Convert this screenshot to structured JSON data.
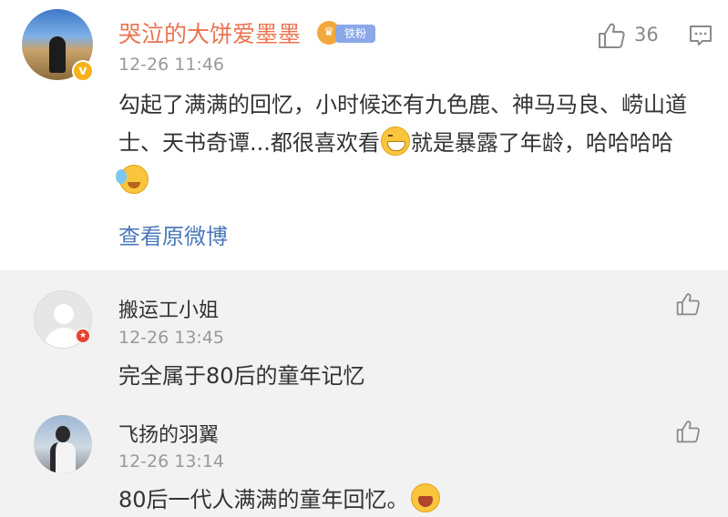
{
  "main_comment": {
    "username": "哭泣的大饼爱墨墨",
    "fan_badge": "铁粉",
    "time": "12-26 11:46",
    "like_count": "36",
    "content_parts": [
      "勾起了满满的回忆，小时候还有九色鹿、神马马良、崂山道士、天书奇谭...都很喜欢看",
      "就是暴露了年龄，哈哈哈哈"
    ],
    "view_original": "查看原微博",
    "icons": [
      "verified-badge-icon",
      "crown-icon",
      "thumb-up-icon",
      "reply-icon",
      "grin-emoji-icon",
      "sweat-emoji-icon"
    ]
  },
  "replies": [
    {
      "username": "搬运工小姐",
      "time": "12-26 13:45",
      "text": "完全属于80后的童年记忆"
    },
    {
      "username": "飞扬的羽翼",
      "time": "12-26 13:14",
      "text": "80后一代人满满的童年回忆。"
    }
  ],
  "colors": {
    "username_main": "#eb7350",
    "link": "#4b79b8",
    "meta": "#999999",
    "reply_bg": "#f2f2f2",
    "fan_badge": "#8aa8e8"
  }
}
